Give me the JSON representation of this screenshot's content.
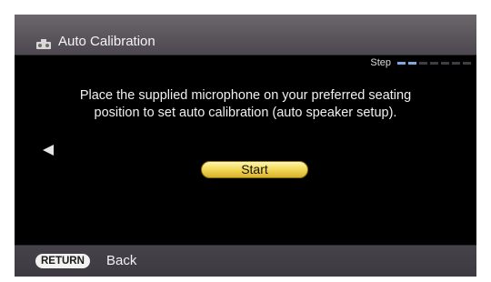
{
  "title_bar": {
    "icon": "speaker-calibration-icon",
    "title": "Auto Calibration"
  },
  "step_indicator": {
    "label": "Step",
    "total_steps": 7,
    "completed_steps": 2,
    "active_color": "#7fa8e0",
    "inactive_color": "#3d3d44"
  },
  "message": {
    "line1": "Place the supplied microphone on your preferred seating",
    "line2": "position to set auto calibration (auto speaker setup)."
  },
  "navigation": {
    "back_arrow_icon": "left-arrow-icon"
  },
  "start_button": {
    "label": "Start",
    "color": "#f3da5c"
  },
  "footer": {
    "return_key_label": "RETURN",
    "back_label": "Back"
  }
}
